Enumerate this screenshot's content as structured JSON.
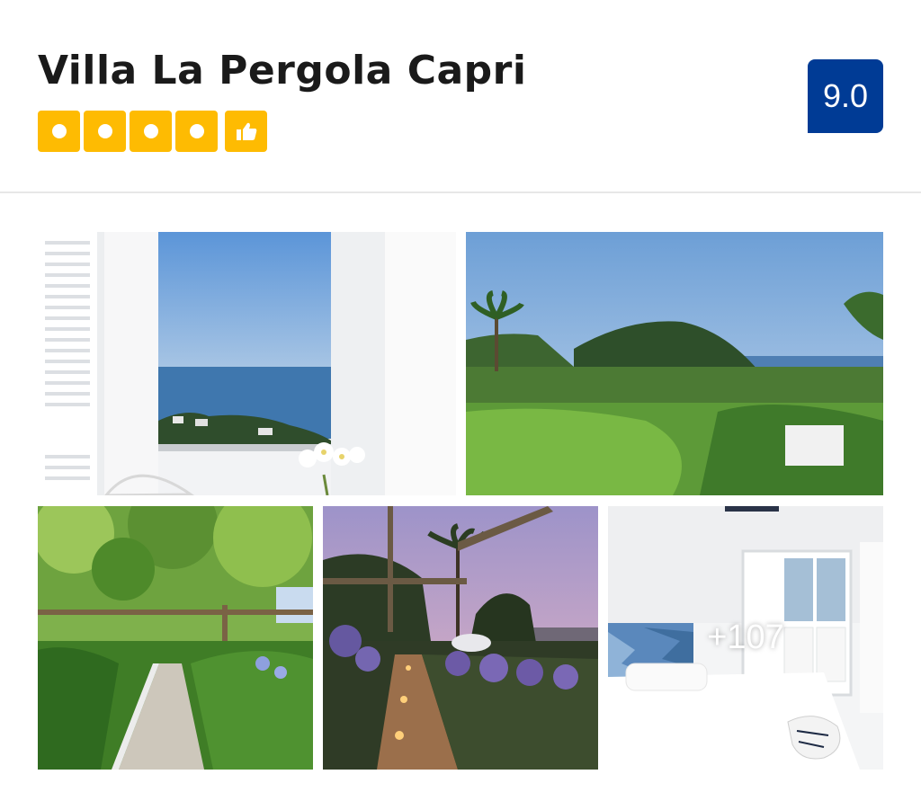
{
  "hotel": {
    "name": "Villa La Pergola Capri",
    "star_rating": 4,
    "preferred_badge_icon": "thumbs-up-icon",
    "review_score": "9.0"
  },
  "gallery": {
    "photos": [
      {
        "name": "photo-window-sea-view"
      },
      {
        "name": "photo-garden-hillside"
      },
      {
        "name": "photo-pergola-path"
      },
      {
        "name": "photo-evening-pergola"
      },
      {
        "name": "photo-bedroom"
      }
    ],
    "more_photos_label": "+107"
  },
  "colors": {
    "star_yellow": "#febb02",
    "score_blue": "#003b95",
    "divider": "#e7e7e7"
  }
}
